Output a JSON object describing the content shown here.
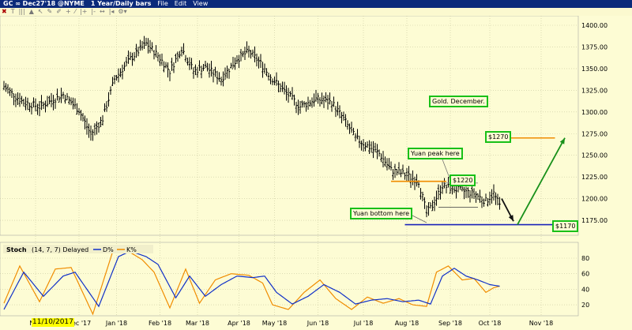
{
  "window": {
    "symbol": "GC ∞ Dec27'18 @NYME",
    "timeframe": "1 Year/Daily bars",
    "menus": [
      "File",
      "Edit",
      "View"
    ]
  },
  "toolbar": {
    "icons": [
      "close-icon",
      "text-icon",
      "bar-icon",
      "mountain-icon",
      "cursor-icon",
      "pencil-icon",
      "eraser-icon",
      "crosshair-icon",
      "trendline-icon",
      "zoom-in-icon",
      "zoom-out-icon",
      "pan-icon",
      "time-icon",
      "settings-icon"
    ]
  },
  "price_axis": [
    "1400.00",
    "1375.00",
    "1350.00",
    "1325.00",
    "1300.00",
    "1275.00",
    "1250.00",
    "1225.00",
    "1200.00",
    "1175.00"
  ],
  "stoch": {
    "title": "Stoch",
    "params": "(14, 7, 7) Delayed",
    "d_label": "D%",
    "k_label": "K%",
    "axis": [
      "80",
      "60",
      "40",
      "20"
    ],
    "d_color": "#1030c8",
    "k_color": "#f08c00"
  },
  "x_axis": {
    "cursor_date": "11/10/2017",
    "months": [
      {
        "label": "Nov",
        "day": 16
      },
      {
        "label": "Dec '17",
        "day": 38
      },
      {
        "label": "Jan '18",
        "day": 57
      },
      {
        "label": "Feb '18",
        "day": 79
      },
      {
        "label": "Mar '18",
        "day": 98
      },
      {
        "label": "Apr '18",
        "day": 119
      },
      {
        "label": "May '18",
        "day": 137
      },
      {
        "label": "Jun '18",
        "day": 159
      },
      {
        "label": "Jul '18",
        "day": 182
      },
      {
        "label": "Aug '18",
        "day": 204
      },
      {
        "label": "Sep '18",
        "day": 226
      },
      {
        "label": "Oct '18",
        "day": 246
      },
      {
        "label": "Nov '18",
        "day": 272
      }
    ]
  },
  "annotations": {
    "gold": "Gold. December.",
    "p1270": "$1270",
    "peak": "Yuan peak here",
    "p1220": "$1220",
    "bottom": "Yuan bottom here",
    "p1170": "$1170"
  },
  "chart_data": {
    "type": "bar",
    "title": "GC Dec27'18 1 Year/Daily bars",
    "ylim": [
      1160,
      1410
    ],
    "price_points": [
      [
        0,
        1329
      ],
      [
        10,
        1311
      ],
      [
        18,
        1306
      ],
      [
        30,
        1320
      ],
      [
        38,
        1302
      ],
      [
        44,
        1274
      ],
      [
        50,
        1292
      ],
      [
        56,
        1338
      ],
      [
        64,
        1361
      ],
      [
        72,
        1379
      ],
      [
        78,
        1365
      ],
      [
        84,
        1347
      ],
      [
        90,
        1374
      ],
      [
        96,
        1347
      ],
      [
        102,
        1352
      ],
      [
        110,
        1338
      ],
      [
        118,
        1361
      ],
      [
        124,
        1370
      ],
      [
        130,
        1356
      ],
      [
        136,
        1338
      ],
      [
        142,
        1324
      ],
      [
        150,
        1306
      ],
      [
        158,
        1315
      ],
      [
        166,
        1311
      ],
      [
        172,
        1292
      ],
      [
        178,
        1270
      ],
      [
        184,
        1261
      ],
      [
        190,
        1252
      ],
      [
        196,
        1233
      ],
      [
        202,
        1229
      ],
      [
        210,
        1220
      ],
      [
        214,
        1183
      ],
      [
        217,
        1192
      ],
      [
        222,
        1215
      ],
      [
        230,
        1210
      ],
      [
        238,
        1206
      ],
      [
        244,
        1197
      ],
      [
        248,
        1206
      ],
      [
        251,
        1192
      ]
    ],
    "stoch_d": [
      [
        0,
        14
      ],
      [
        10,
        62
      ],
      [
        20,
        31
      ],
      [
        30,
        57
      ],
      [
        36,
        62
      ],
      [
        48,
        18
      ],
      [
        58,
        82
      ],
      [
        64,
        89
      ],
      [
        72,
        82
      ],
      [
        78,
        72
      ],
      [
        87,
        29
      ],
      [
        94,
        57
      ],
      [
        102,
        31
      ],
      [
        110,
        46
      ],
      [
        118,
        57
      ],
      [
        126,
        55
      ],
      [
        132,
        57
      ],
      [
        138,
        36
      ],
      [
        146,
        21
      ],
      [
        154,
        31
      ],
      [
        162,
        46
      ],
      [
        170,
        36
      ],
      [
        178,
        21
      ],
      [
        186,
        26
      ],
      [
        194,
        28
      ],
      [
        202,
        24
      ],
      [
        210,
        26
      ],
      [
        216,
        21
      ],
      [
        222,
        57
      ],
      [
        228,
        67
      ],
      [
        234,
        57
      ],
      [
        240,
        52
      ],
      [
        246,
        46
      ],
      [
        251,
        44
      ]
    ],
    "stoch_k": [
      [
        0,
        22
      ],
      [
        8,
        70
      ],
      [
        18,
        24
      ],
      [
        26,
        66
      ],
      [
        34,
        68
      ],
      [
        45,
        8
      ],
      [
        55,
        88
      ],
      [
        61,
        92
      ],
      [
        70,
        78
      ],
      [
        76,
        62
      ],
      [
        84,
        16
      ],
      [
        92,
        66
      ],
      [
        99,
        22
      ],
      [
        107,
        52
      ],
      [
        115,
        60
      ],
      [
        124,
        58
      ],
      [
        131,
        48
      ],
      [
        136,
        20
      ],
      [
        144,
        14
      ],
      [
        152,
        36
      ],
      [
        160,
        52
      ],
      [
        168,
        28
      ],
      [
        176,
        14
      ],
      [
        184,
        30
      ],
      [
        192,
        22
      ],
      [
        200,
        28
      ],
      [
        207,
        20
      ],
      [
        214,
        18
      ],
      [
        219,
        62
      ],
      [
        225,
        70
      ],
      [
        232,
        52
      ],
      [
        238,
        54
      ],
      [
        244,
        36
      ],
      [
        248,
        42
      ],
      [
        251,
        44
      ]
    ],
    "levels": [
      {
        "price": 1220,
        "from": 196,
        "to": 224,
        "color": "#f08c00"
      },
      {
        "price": 1170,
        "from": 203,
        "to": 278,
        "color": "#1a22b8"
      },
      {
        "price": 1270,
        "from": 255,
        "to": 279,
        "color": "#f08c00"
      },
      {
        "price": 1218,
        "from": 222,
        "to": 240,
        "color": "#888888"
      },
      {
        "price": 1190,
        "from": 220,
        "to": 240,
        "color": "#555555"
      }
    ],
    "arrows": [
      {
        "from": [
          252,
          1200
        ],
        "to": [
          258,
          1174
        ],
        "color": "#111111"
      },
      {
        "from": [
          260,
          1170
        ],
        "to": [
          284,
          1270
        ],
        "color": "#18901a"
      }
    ]
  }
}
